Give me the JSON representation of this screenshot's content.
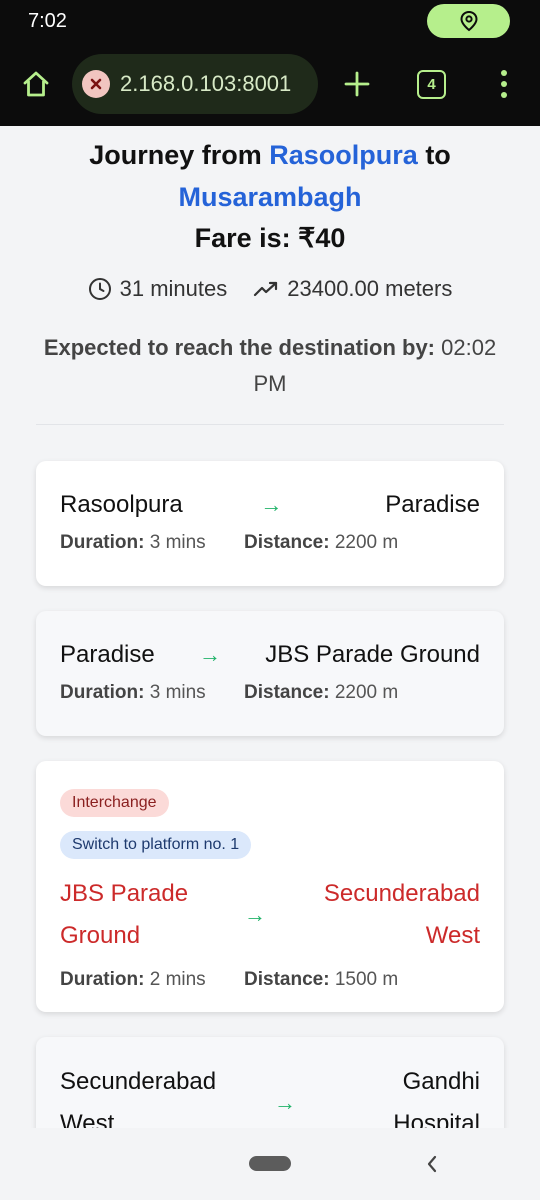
{
  "status_bar": {
    "time": "7:02",
    "location_icon": "location-pin-icon"
  },
  "browser": {
    "url": "2.168.0.103:8001",
    "tab_count": "4",
    "colors": {
      "accent": "#b6ef8c",
      "bar_bg": "#0c0c0c"
    }
  },
  "summary": {
    "title_prefix": "Journey from",
    "origin": "Rasoolpura",
    "title_mid": "to",
    "destination": "Musarambagh",
    "fare_label": "Fare is: ₹40",
    "duration": "31 minutes",
    "distance": "23400.00 meters",
    "expected_label": "Expected to reach the destination by:",
    "expected_time": "02:02 PM"
  },
  "segments": [
    {
      "from": "Rasoolpura",
      "to": "Paradise",
      "duration_label": "Duration:",
      "duration": "3 mins",
      "distance_label": "Distance:",
      "distance": "2200 m"
    },
    {
      "from": "Paradise",
      "to": "JBS Parade Ground",
      "duration_label": "Duration:",
      "duration": "3 mins",
      "distance_label": "Distance:",
      "distance": "2200 m"
    },
    {
      "interchange_badge": "Interchange",
      "platform_badge": "Switch to platform no. 1",
      "from_line1": "JBS Parade",
      "from_line2": "Ground",
      "to_line1": "Secunderabad",
      "to_line2": "West",
      "duration_label": "Duration:",
      "duration": "2 mins",
      "distance_label": "Distance:",
      "distance": "1500 m"
    },
    {
      "from_line1": "Secunderabad",
      "from_line2": "West",
      "to_line1": "Gandhi",
      "to_line2": "Hospital"
    }
  ],
  "arrow_glyph": "→",
  "colors": {
    "link_blue": "#2563d8",
    "interchange_red": "#cc2a2a",
    "arrow_green": "#22b36a"
  }
}
